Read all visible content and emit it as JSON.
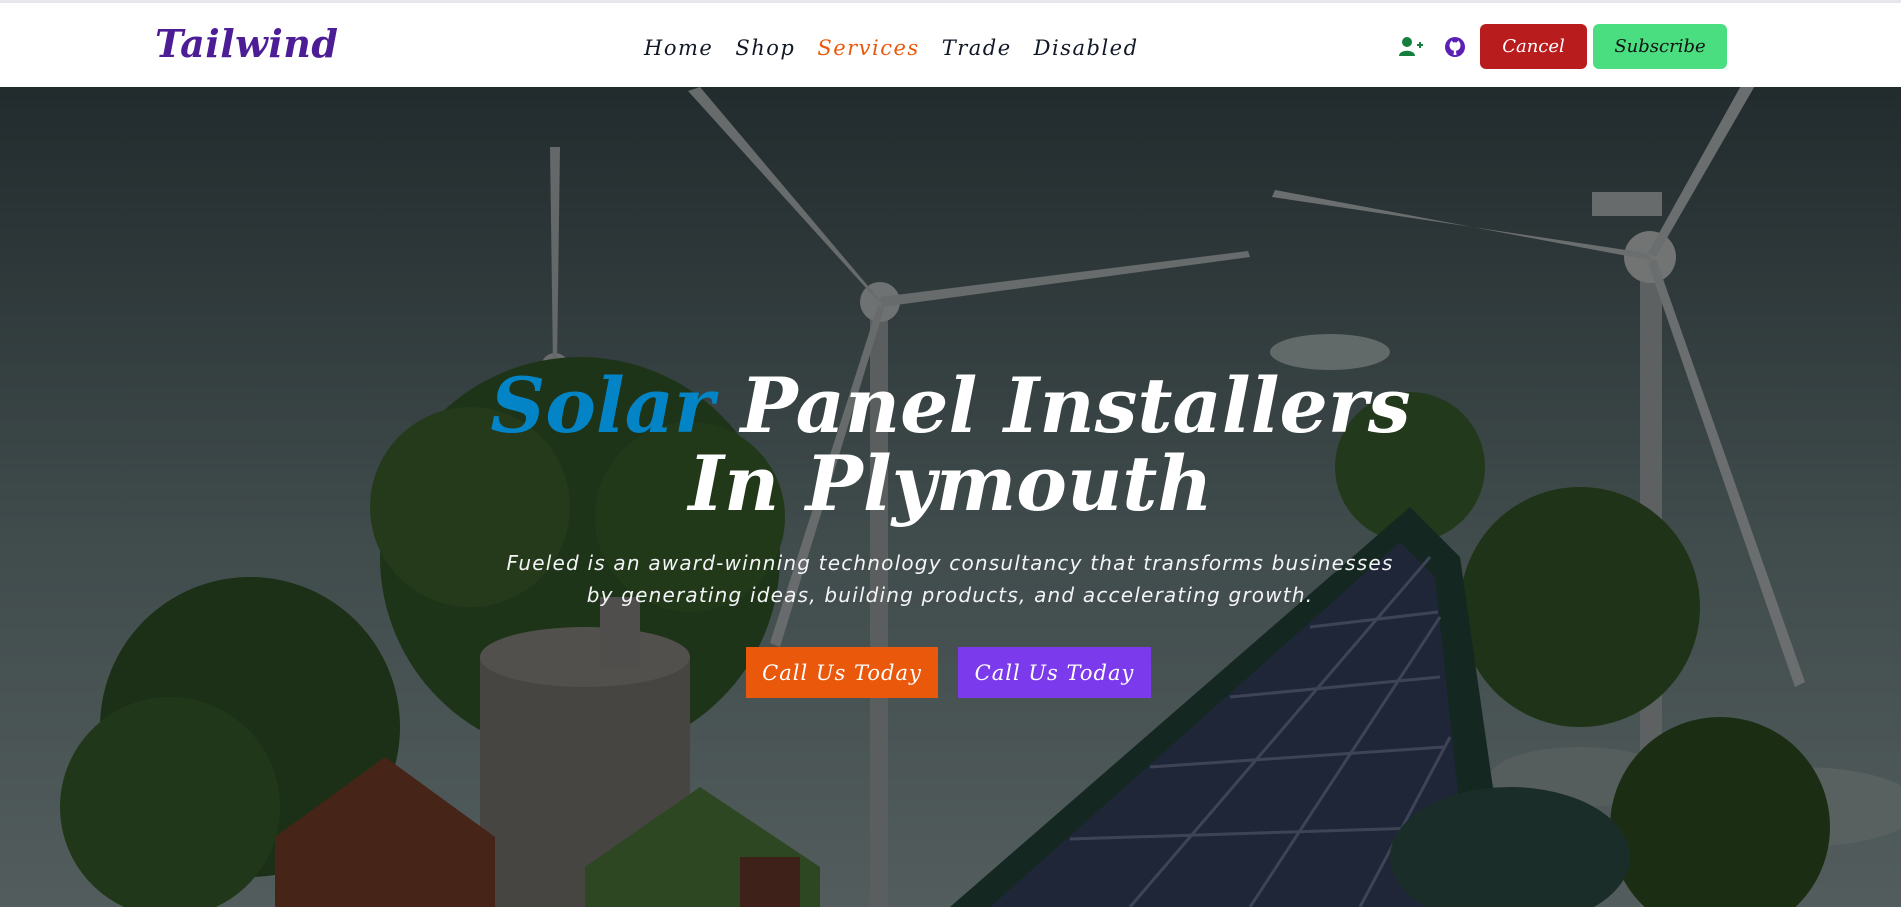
{
  "brand": {
    "logo_text": "Tailwind"
  },
  "nav": {
    "items": [
      {
        "label": "Home"
      },
      {
        "label": "Shop"
      },
      {
        "label": "Services"
      },
      {
        "label": "Trade"
      },
      {
        "label": "Disabled"
      }
    ],
    "active": "Services"
  },
  "header_actions": {
    "icons": [
      "user-plus-icon",
      "github-icon"
    ],
    "cancel_label": "Cancel",
    "subscribe_label": "Subscribe"
  },
  "hero": {
    "title_accent": "Solar",
    "title_rest": "Panel Installers",
    "title_line2": "In Plymouth",
    "subtitle": "Fueled is an award-winning technology consultancy that transforms businesses by generating ideas, building products, and accelerating growth.",
    "cta_primary": "Call Us Today",
    "cta_secondary": "Call Us Today"
  },
  "colors": {
    "logo": "#4c1d95",
    "nav_active": "#ea580c",
    "title_accent": "#0284c7",
    "cancel_bg": "#b91c1c",
    "subscribe_bg": "#4ade80",
    "cta_primary_bg": "#ea580c",
    "cta_secondary_bg": "#7c3aed"
  }
}
